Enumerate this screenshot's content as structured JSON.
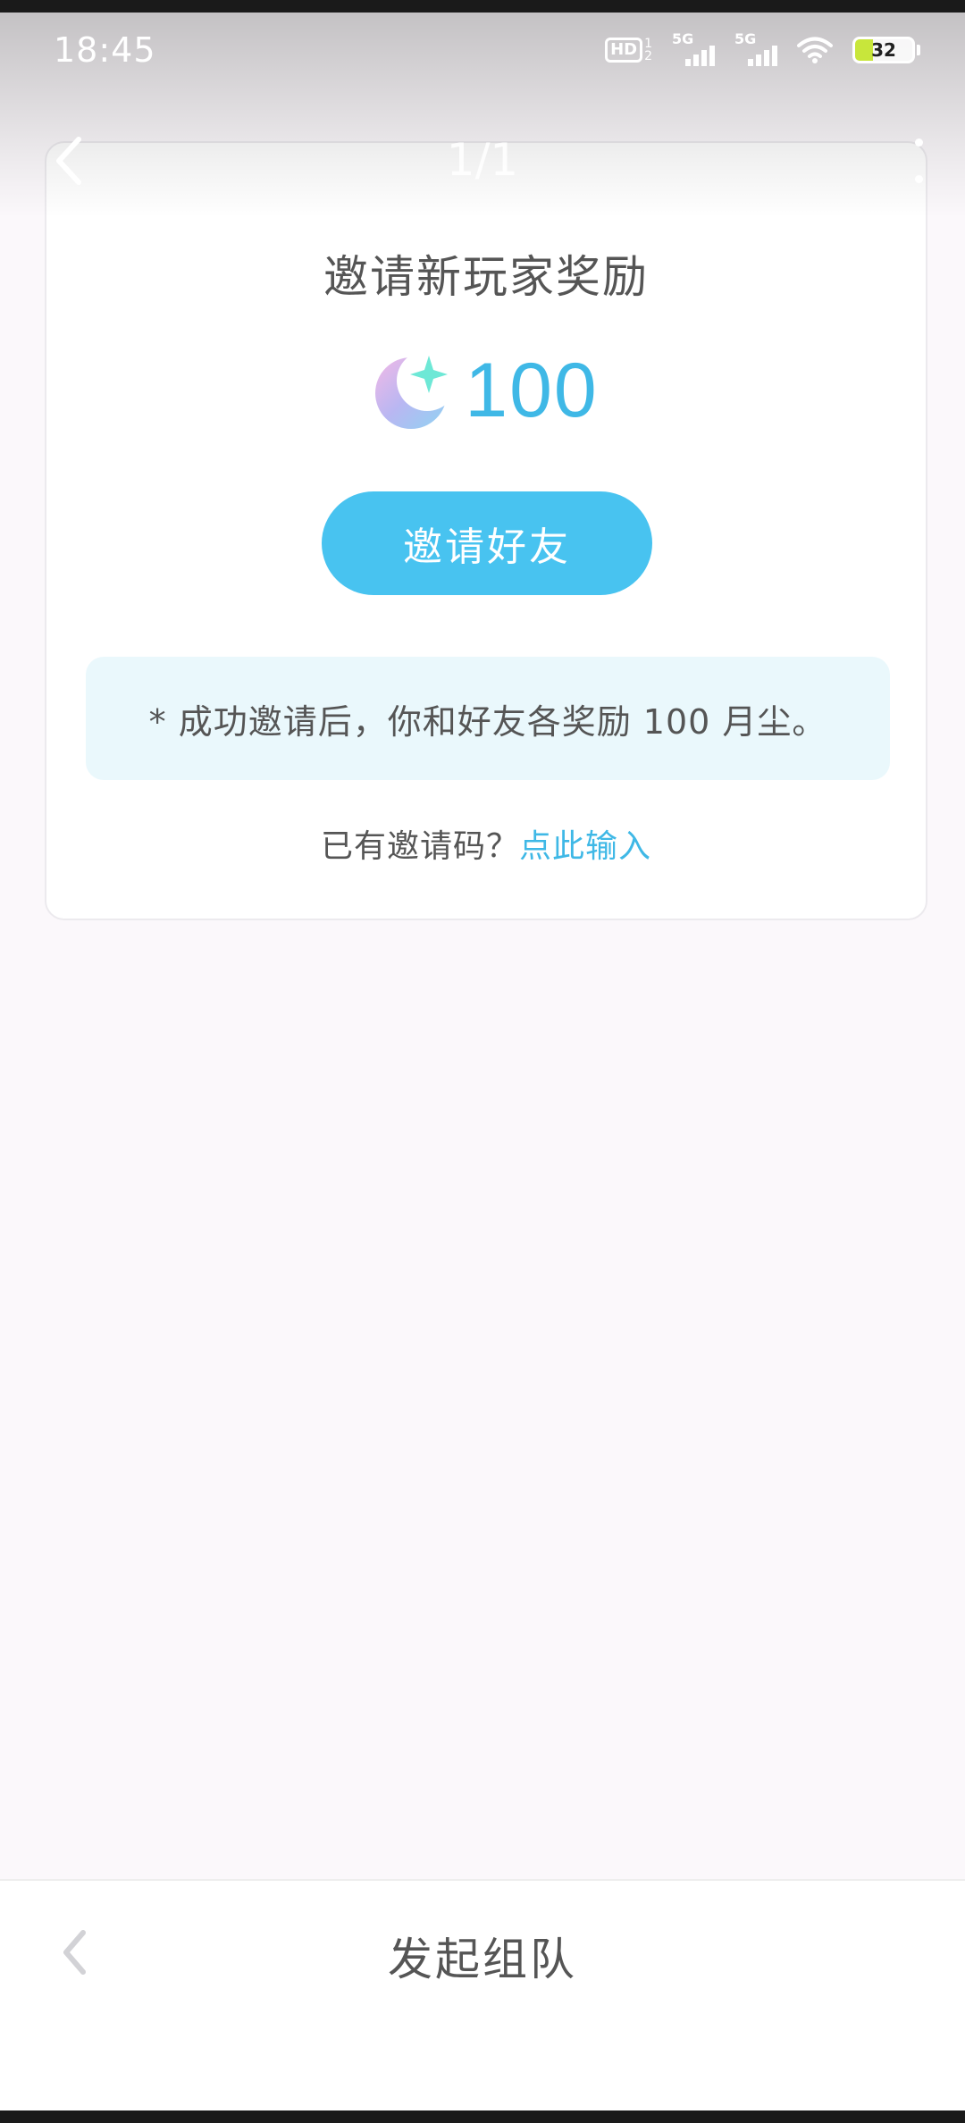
{
  "status_bar": {
    "time": "18:45",
    "hd_label": "HD",
    "hd_sub_top": "1",
    "hd_sub_bottom": "2",
    "sim1_label": "5G",
    "sim2_label": "5G",
    "battery_level": "32",
    "battery_fraction": 0.32,
    "battery_color": "#c8e63b"
  },
  "header": {
    "page_indicator": "1/1",
    "back_icon": "chevron-left-icon",
    "more_icon": "more-vertical-icon"
  },
  "card": {
    "title": "邀请新玩家奖励",
    "reward_icon": "moon-star-icon",
    "reward_amount": "100",
    "invite_button_label": "邀请好友",
    "notice": "* 成功邀请后，你和好友各奖励 100 月尘。",
    "code_prompt": "已有邀请码？",
    "code_link": "点此输入"
  },
  "bottom_bar": {
    "title": "发起组队",
    "back_icon": "chevron-left-icon"
  },
  "colors": {
    "accent": "#48c3f0",
    "link": "#3fb8e6",
    "notice_bg": "#eaf8fc"
  }
}
